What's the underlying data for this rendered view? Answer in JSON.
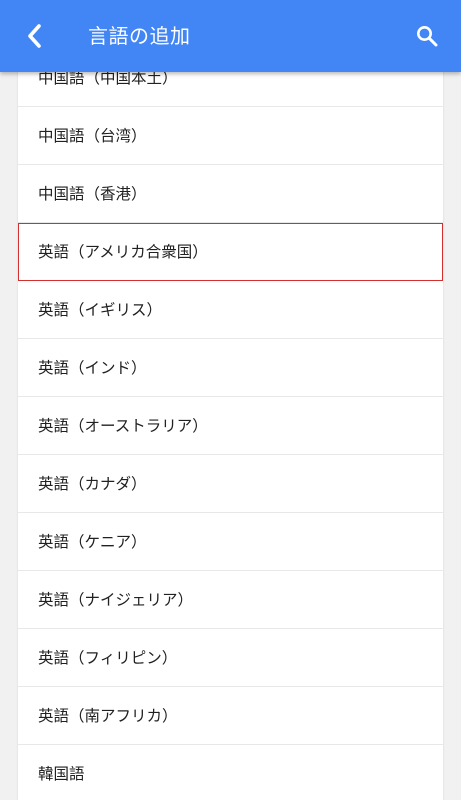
{
  "header": {
    "title": "言語の追加",
    "background_color": "#4285f4",
    "back_icon": "chevron-left-icon",
    "search_icon": "search-icon"
  },
  "languages": [
    "中国語（中国本土）",
    "中国語（台湾）",
    "中国語（香港）",
    "英語（アメリカ合衆国）",
    "英語（イギリス）",
    "英語（インド）",
    "英語（オーストラリア）",
    "英語（カナダ）",
    "英語（ケニア）",
    "英語（ナイジェリア）",
    "英語（フィリピン）",
    "英語（南アフリカ）",
    "韓国語"
  ],
  "highlight_color": "#d32f2f"
}
